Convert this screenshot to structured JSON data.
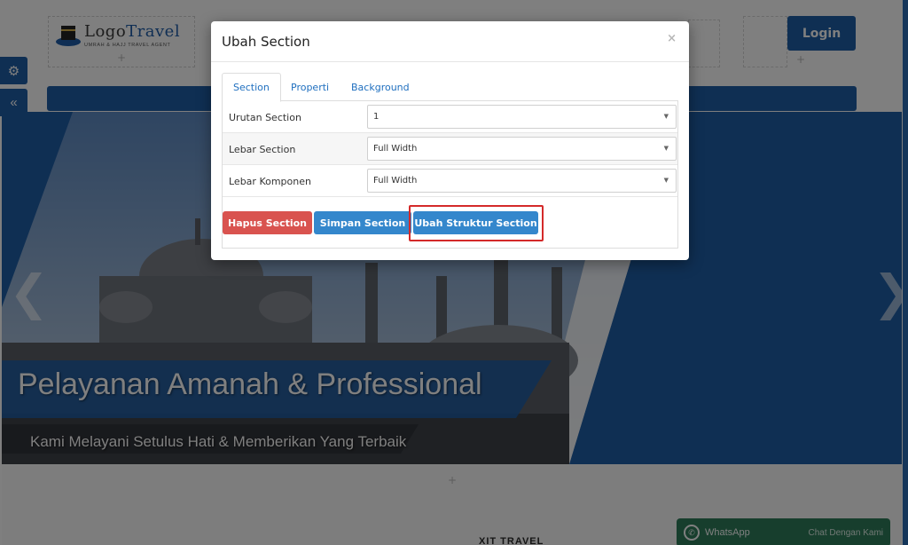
{
  "header": {
    "logo": {
      "brand_part1": "Logo",
      "brand_part2": "Travel",
      "tagline": "UMRAH & HAJJ TRAVEL AGENT"
    },
    "login_label": "Login",
    "add_symbol": "+"
  },
  "sidebar": {
    "settings_icon": "gears-icon",
    "collapse_icon": "double-chevron-left-icon"
  },
  "hero": {
    "title": "Pelayanan Amanah & Professional",
    "subtitle": "Kami Melayani Setulus Hati & Memberikan Yang Terbaik",
    "prev_arrow": "❮",
    "next_arrow": "❯"
  },
  "below": {
    "heading": "XIT TRAVEL",
    "add_symbol": "+"
  },
  "whatsapp": {
    "label": "WhatsApp",
    "cta": "Chat Dengan Kami"
  },
  "modal": {
    "title": "Ubah Section",
    "close_symbol": "×",
    "tabs": [
      {
        "label": "Section",
        "active": true
      },
      {
        "label": "Properti",
        "active": false
      },
      {
        "label": "Background",
        "active": false
      }
    ],
    "fields": [
      {
        "label": "Urutan Section",
        "value": "1"
      },
      {
        "label": "Lebar Section",
        "value": "Full Width"
      },
      {
        "label": "Lebar Komponen",
        "value": "Full Width"
      }
    ],
    "buttons": {
      "delete": "Hapus Section",
      "save": "Simpan Section",
      "edit_structure": "Ubah Struktur Section"
    }
  },
  "colors": {
    "primary": "#1f5ea6",
    "danger": "#d9534f",
    "button_primary": "#3487cc",
    "highlight": "#d42a2a",
    "whatsapp": "#2e7d5b"
  }
}
